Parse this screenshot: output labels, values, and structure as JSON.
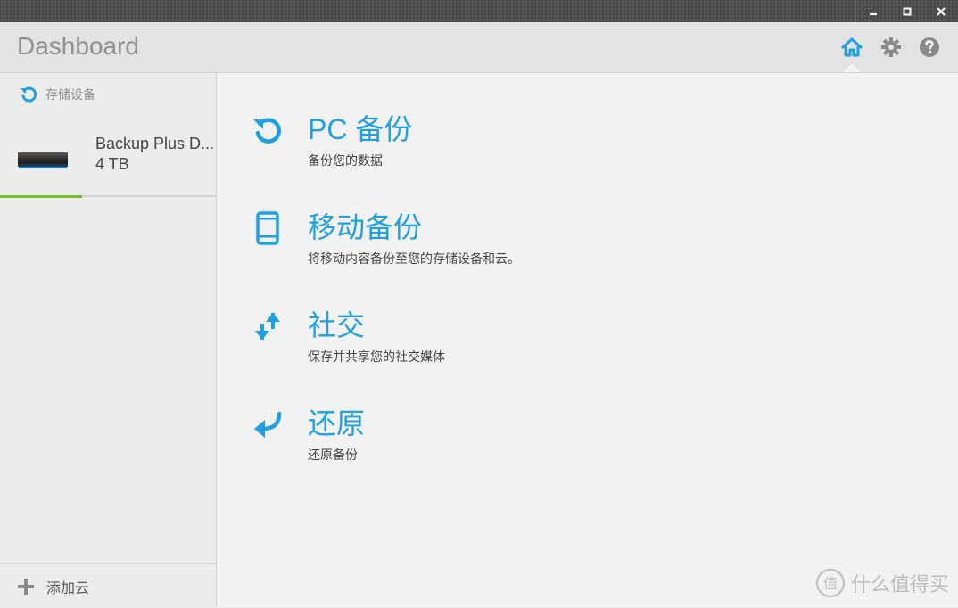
{
  "header": {
    "title": "Dashboard",
    "icons": [
      "home-icon",
      "gear-icon",
      "help-icon"
    ],
    "accent": "#1fa0e3"
  },
  "window_controls": [
    "minimize-icon",
    "maximize-icon",
    "close-icon"
  ],
  "sidebar": {
    "section_label": "存储设备",
    "device": {
      "name": "Backup Plus D...",
      "size": "4 TB"
    },
    "add_cloud_label": "添加云"
  },
  "features": [
    {
      "icon": "refresh-icon",
      "title": "PC 备份",
      "desc": "备份您的数据"
    },
    {
      "icon": "phone-icon",
      "title": "移动备份",
      "desc": "将移动内容备份至您的存储设备和云。"
    },
    {
      "icon": "swap-arrows-icon",
      "title": "社交",
      "desc": "保存并共享您的社交媒体"
    },
    {
      "icon": "return-arrow-icon",
      "title": "还原",
      "desc": "还原备份"
    }
  ],
  "watermark": {
    "text": "什么值得买",
    "logo_text": "值"
  },
  "colors": {
    "active_indicator": "#7cbf2e",
    "title_text": "#8f8f8f"
  }
}
